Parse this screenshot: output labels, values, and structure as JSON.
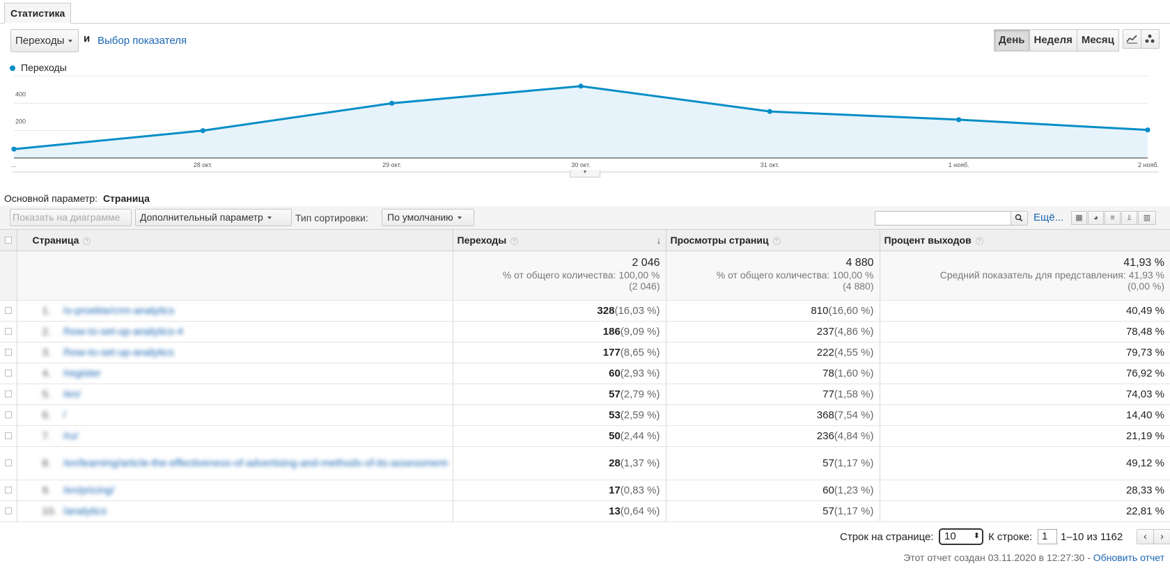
{
  "tab": {
    "label": "Статистика"
  },
  "chart_controls": {
    "metric": "Переходы",
    "and_text": "и",
    "select_metric_link": "Выбор показателя",
    "periods": [
      "День",
      "Неделя",
      "Месяц"
    ],
    "active_period": "День"
  },
  "chart_data": {
    "type": "area",
    "legend": "Переходы",
    "series_color": "#058dc7",
    "x": [
      "...",
      "28 окт.",
      "29 окт.",
      "30 окт.",
      "31 окт.",
      "1 нояб.",
      "2 нояб."
    ],
    "values": [
      65,
      200,
      400,
      525,
      340,
      280,
      205
    ],
    "yticks": [
      "600",
      "400",
      "200"
    ],
    "ylim": [
      0,
      600
    ],
    "grid": true
  },
  "primary_dim": {
    "label": "Основной параметр:",
    "value": "Страница"
  },
  "toolbar": {
    "plot_rows": "Показать на диаграмме",
    "secondary_dim": "Дополнительный параметр",
    "sort_label": "Тип сортировки:",
    "sort_value": "По умолчанию",
    "more": "Ещё..."
  },
  "table": {
    "headers": [
      "Страница",
      "Переходы",
      "Просмотры страниц",
      "Процент выходов"
    ],
    "totals": {
      "entrances": "2 046",
      "entrances_sub1": "% от общего количества: 100,00 %",
      "entrances_sub2": "(2 046)",
      "pageviews": "4 880",
      "pageviews_sub1": "% от общего количества: 100,00 %",
      "pageviews_sub2": "(4 880)",
      "exit": "41,93 %",
      "exit_sub1": "Средний показатель для представления: 41,93 %",
      "exit_sub2": "(0,00 %)"
    },
    "rows": [
      {
        "idx": "1.",
        "page": "/o-proekte/crm-analytics",
        "e": "328",
        "ep": "(16,03 %)",
        "pv": "810",
        "pvp": "(16,60 %)",
        "ex": "40,49 %"
      },
      {
        "idx": "2.",
        "page": "/how-to-set-up-analytics-4",
        "e": "186",
        "ep": "(9,09 %)",
        "pv": "237",
        "pvp": "(4,86 %)",
        "ex": "78,48 %"
      },
      {
        "idx": "3.",
        "page": "/how-to-set-up-analytics",
        "e": "177",
        "ep": "(8,65 %)",
        "pv": "222",
        "pvp": "(4,55 %)",
        "ex": "79,73 %"
      },
      {
        "idx": "4.",
        "page": "/register",
        "e": "60",
        "ep": "(2,93 %)",
        "pv": "78",
        "pvp": "(1,60 %)",
        "ex": "76,92 %"
      },
      {
        "idx": "5.",
        "page": "/en/",
        "e": "57",
        "ep": "(2,79 %)",
        "pv": "77",
        "pvp": "(1,58 %)",
        "ex": "74,03 %"
      },
      {
        "idx": "6.",
        "page": "/",
        "e": "53",
        "ep": "(2,59 %)",
        "pv": "368",
        "pvp": "(7,54 %)",
        "ex": "14,40 %"
      },
      {
        "idx": "7.",
        "page": "/ru/",
        "e": "50",
        "ep": "(2,44 %)",
        "pv": "236",
        "pvp": "(4,84 %)",
        "ex": "21,19 %"
      },
      {
        "idx": "8.",
        "page": "/en/learning/article-the-effectiveness-of-advertising-and-methods-of-its-assessment-",
        "e": "28",
        "ep": "(1,37 %)",
        "pv": "57",
        "pvp": "(1,17 %)",
        "ex": "49,12 %"
      },
      {
        "idx": "9.",
        "page": "/en/pricing/",
        "e": "17",
        "ep": "(0,83 %)",
        "pv": "60",
        "pvp": "(1,23 %)",
        "ex": "28,33 %"
      },
      {
        "idx": "10.",
        "page": "/analytics",
        "e": "13",
        "ep": "(0,64 %)",
        "pv": "57",
        "pvp": "(1,17 %)",
        "ex": "22,81 %"
      }
    ]
  },
  "pagination": {
    "rows_label": "Строк на странице:",
    "rows_value": "10",
    "goto_label": "К строке:",
    "goto_value": "1",
    "range": "1–10 из 1162"
  },
  "footer": {
    "created": "Этот отчет создан 03.11.2020 в 12:27:30 -",
    "refresh": "Обновить отчет"
  }
}
